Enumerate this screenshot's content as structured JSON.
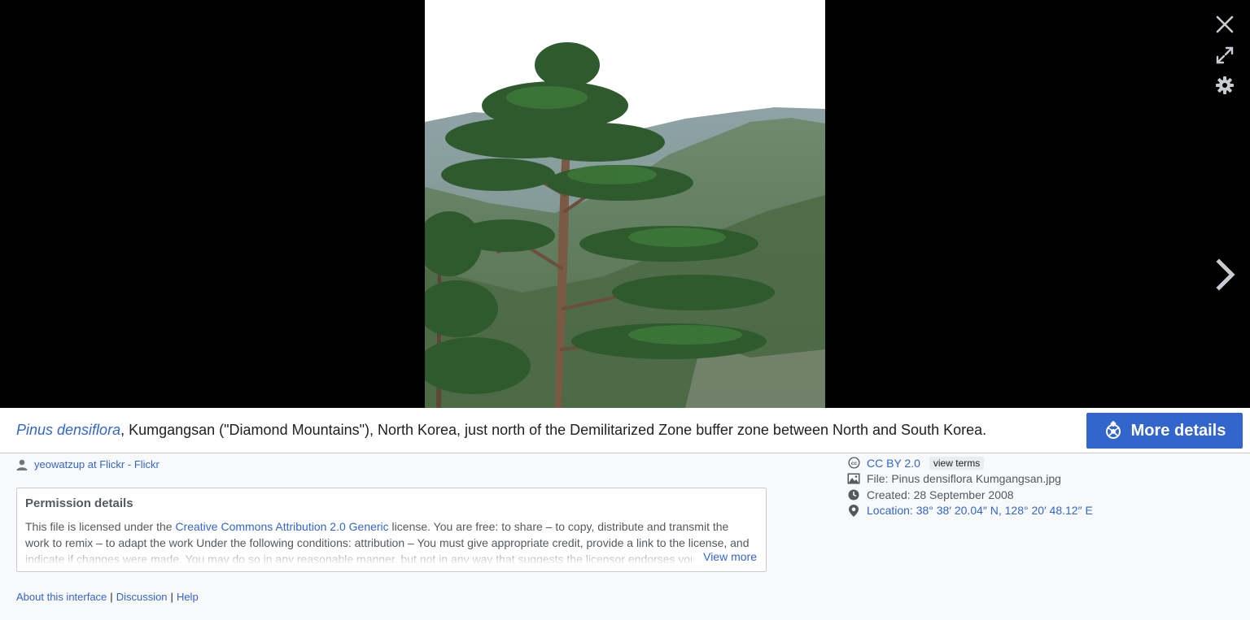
{
  "viewer": {
    "controls": {
      "close_icon": "close-icon",
      "fullscreen_icon": "fullscreen-icon",
      "settings_icon": "gear-icon",
      "next_icon": "chevron-right-icon"
    }
  },
  "caption": {
    "species": "Pinus densiflora",
    "text": ", Kumgangsan (\"Diamond Mountains\"), North Korea, just north of the Demilitarized Zone buffer zone between North and South Korea.",
    "more_details_label": "More details"
  },
  "author": {
    "name": "yeowatzup at Flickr - Flickr"
  },
  "permission": {
    "title": "Permission details",
    "intro": "This file is licensed under the ",
    "license_link": "Creative Commons Attribution 2.0 Generic",
    "body": " license. You are free: to share – to copy, distribute and transmit the work to remix – to adapt the work Under the following conditions: attribution – You must give appropriate credit, provide a link to the license, and indicate if changes were made. You may do so in any reasonable manner, but not in any way that suggests the licensor endorses you or your use.",
    "view_more": "View more"
  },
  "meta": {
    "license": "CC BY 2.0",
    "view_terms": "view terms",
    "file": "File: Pinus densiflora Kumgangsan.jpg",
    "created": "Created: 28 September 2008",
    "location": "Location: 38° 38′ 20.04″ N, 128° 20′ 48.12″ E"
  },
  "footer": {
    "about": "About this interface",
    "discussion": "Discussion",
    "help": "Help"
  },
  "colors": {
    "accent": "#3366cc",
    "viewer_bg": "#000000",
    "panel_bg": "#f8f9fa"
  }
}
